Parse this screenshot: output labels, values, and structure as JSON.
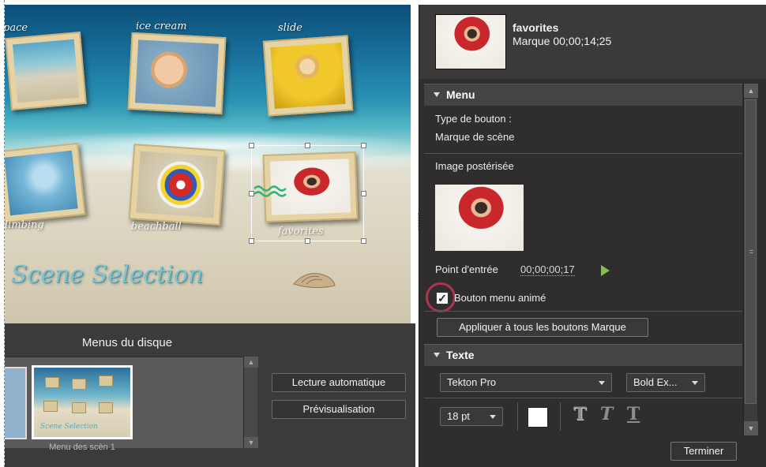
{
  "preview": {
    "labels": {
      "space": "pace",
      "ice_cream": "ice cream",
      "slide": "slide",
      "climbing": "limbing",
      "beachball": "beachball",
      "favorites": "favorites"
    },
    "scene_title": "Scene Selection"
  },
  "disc_menus": {
    "title": "Menus du disque",
    "thumbnail_caption": "Menu des scèn 1",
    "autoplay_button": "Lecture automatique",
    "preview_button": "Prévisualisation"
  },
  "properties": {
    "header": {
      "item_name": "favorites",
      "marker_line": "Marque 00;00;14;25"
    },
    "menu_section": {
      "title": "Menu",
      "button_type_label": "Type de bouton :",
      "button_type_value": "Marque de scène",
      "poster_image_label": "Image postérisée",
      "in_point_label": "Point d'entrée",
      "in_point_value": "00;00;00;17",
      "animated_button_label": "Bouton menu animé",
      "animated_button_checked": true,
      "checkmark": "✓",
      "apply_all_button": "Appliquer à tous les boutons Marque"
    },
    "text_section": {
      "title": "Texte",
      "font_family": "Tekton Pro",
      "font_style": "Bold Ex...",
      "font_size": "18 pt",
      "text_color": "#ffffff",
      "style_glyphs": [
        "T",
        "T",
        "T"
      ]
    },
    "done_button": "Terminer"
  },
  "colors": {
    "panel_bg": "#2f2d2d",
    "section_header": "#454343",
    "highlight_ring": "#b2334f",
    "play_green": "#7fc24a"
  }
}
